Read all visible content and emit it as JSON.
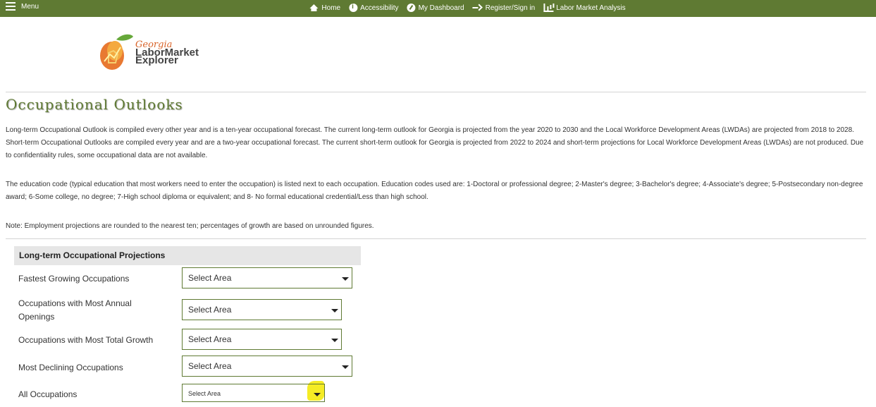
{
  "nav": {
    "menu_label": "Menu",
    "items": [
      {
        "label": "Home",
        "icon": "home-icon"
      },
      {
        "label": "Accessibility",
        "icon": "accessibility-icon"
      },
      {
        "label": "My Dashboard",
        "icon": "dashboard-icon"
      },
      {
        "label": "Register/Sign in",
        "icon": "sign-in-icon"
      },
      {
        "label": "Labor Market Analysis",
        "icon": "chart-icon"
      }
    ]
  },
  "logo": {
    "line1": "Georgia",
    "line2": "LaborMarket",
    "line3": "Explorer"
  },
  "page": {
    "title": "Occupational Outlooks",
    "para1": "Long-term Occupational Outlook is compiled every other year and is a ten-year occupational forecast. The current long-term outlook for Georgia is projected from the year 2020 to 2030 and the Local Workforce Development Areas (LWDAs) are projected from 2018 to 2028. Short-term Occupational Outlooks are compiled every year and are a two-year occupational forecast. The current short-term outlook for Georgia is projected from 2022 to 2024 and short-term projections for Local Workforce Development Areas (LWDAs) are not produced. Due to confidentiality rules, some occupational data are not available.",
    "para2": "The education code (typical education that most workers need to enter the occupation) is listed next to each occupation. Education codes used are: 1-Doctoral or professional degree; 2-Master's degree; 3-Bachelor's degree; 4-Associate's degree; 5-Postsecondary non-degree award; 6-Some college, no degree; 7-High school diploma or equivalent; and 8- No formal educational credential/Less than high school.",
    "note": "Note: Employment projections are rounded to the nearest ten; percentages of growth are based on unrounded figures."
  },
  "projections": {
    "heading": "Long-term Occupational Projections",
    "rows": [
      {
        "label": "Fastest Growing Occupations",
        "select": "Select Area"
      },
      {
        "label": "Occupations with Most Annual Openings",
        "select": "Select Area"
      },
      {
        "label": "Occupations with Most Total Growth",
        "select": "Select Area"
      },
      {
        "label": "Most Declining Occupations",
        "select": "Select Area"
      },
      {
        "label": "All Occupations",
        "select": "Select Area"
      }
    ]
  },
  "colors": {
    "brand_green": "#5f7a33",
    "accent_orange": "#d9642a",
    "highlight_yellow": "#f5ec25"
  }
}
